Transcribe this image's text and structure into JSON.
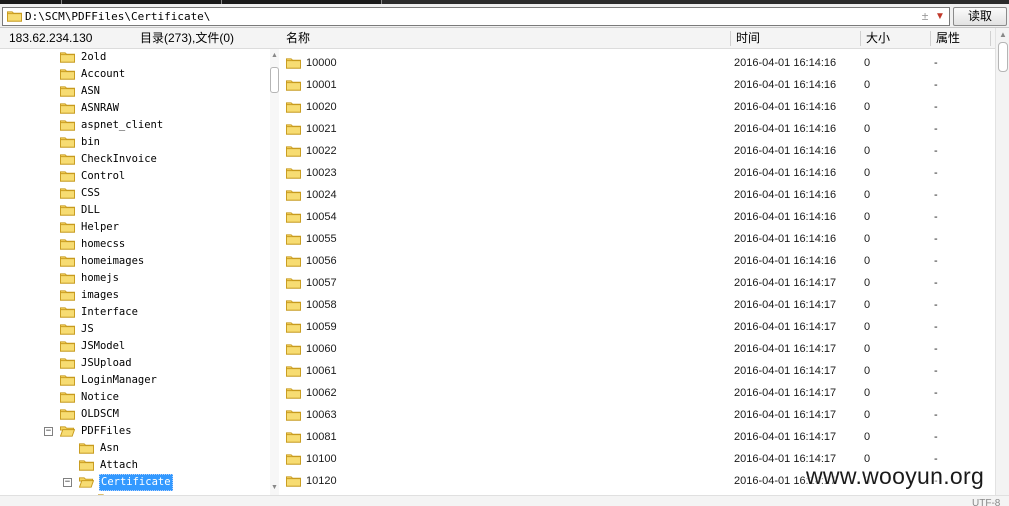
{
  "address_bar": {
    "path": "D:\\SCM\\PDFFiles\\Certificate\\",
    "plus_glyph": "±",
    "dropdown_glyph": "▼",
    "read_label": "读取"
  },
  "header": {
    "ip": "183.62.234.130",
    "count_label": "目录(273),文件(0)",
    "columns": {
      "name": "名称",
      "time": "时间",
      "size": "大小",
      "attr": "属性"
    }
  },
  "tree": {
    "items": [
      {
        "label": "2old"
      },
      {
        "label": "Account"
      },
      {
        "label": "ASN"
      },
      {
        "label": "ASNRAW"
      },
      {
        "label": "aspnet_client"
      },
      {
        "label": "bin"
      },
      {
        "label": "CheckInvoice"
      },
      {
        "label": "Control"
      },
      {
        "label": "CSS"
      },
      {
        "label": "DLL"
      },
      {
        "label": "Helper"
      },
      {
        "label": "homecss"
      },
      {
        "label": "homeimages"
      },
      {
        "label": "homejs"
      },
      {
        "label": "images"
      },
      {
        "label": "Interface"
      },
      {
        "label": "JS"
      },
      {
        "label": "JSModel"
      },
      {
        "label": "JSUpload"
      },
      {
        "label": "LoginManager"
      },
      {
        "label": "Notice"
      },
      {
        "label": "OLDSCM"
      },
      {
        "label": "PDFFiles",
        "expander": "−"
      },
      {
        "label": "Asn"
      },
      {
        "label": "Attach"
      },
      {
        "label": "Certificate",
        "expander": "−"
      }
    ]
  },
  "files": [
    {
      "name": "10000",
      "time": "2016-04-01 16:14:16",
      "size": "0",
      "attr": "-"
    },
    {
      "name": "10001",
      "time": "2016-04-01 16:14:16",
      "size": "0",
      "attr": "-"
    },
    {
      "name": "10020",
      "time": "2016-04-01 16:14:16",
      "size": "0",
      "attr": "-"
    },
    {
      "name": "10021",
      "time": "2016-04-01 16:14:16",
      "size": "0",
      "attr": "-"
    },
    {
      "name": "10022",
      "time": "2016-04-01 16:14:16",
      "size": "0",
      "attr": "-"
    },
    {
      "name": "10023",
      "time": "2016-04-01 16:14:16",
      "size": "0",
      "attr": "-"
    },
    {
      "name": "10024",
      "time": "2016-04-01 16:14:16",
      "size": "0",
      "attr": "-"
    },
    {
      "name": "10054",
      "time": "2016-04-01 16:14:16",
      "size": "0",
      "attr": "-"
    },
    {
      "name": "10055",
      "time": "2016-04-01 16:14:16",
      "size": "0",
      "attr": "-"
    },
    {
      "name": "10056",
      "time": "2016-04-01 16:14:16",
      "size": "0",
      "attr": "-"
    },
    {
      "name": "10057",
      "time": "2016-04-01 16:14:17",
      "size": "0",
      "attr": "-"
    },
    {
      "name": "10058",
      "time": "2016-04-01 16:14:17",
      "size": "0",
      "attr": "-"
    },
    {
      "name": "10059",
      "time": "2016-04-01 16:14:17",
      "size": "0",
      "attr": "-"
    },
    {
      "name": "10060",
      "time": "2016-04-01 16:14:17",
      "size": "0",
      "attr": "-"
    },
    {
      "name": "10061",
      "time": "2016-04-01 16:14:17",
      "size": "0",
      "attr": "-"
    },
    {
      "name": "10062",
      "time": "2016-04-01 16:14:17",
      "size": "0",
      "attr": "-"
    },
    {
      "name": "10063",
      "time": "2016-04-01 16:14:17",
      "size": "0",
      "attr": "-"
    },
    {
      "name": "10081",
      "time": "2016-04-01 16:14:17",
      "size": "0",
      "attr": "-"
    },
    {
      "name": "10100",
      "time": "2016-04-01 16:14:17",
      "size": "0",
      "attr": "-"
    },
    {
      "name": "10120",
      "time": "2016-04-01 16:14:17",
      "size": "0",
      "attr": "-"
    }
  ],
  "status": {
    "encoding": "UTF-8"
  },
  "watermark": "www.wooyun.org",
  "icons": {
    "folder": "folder-icon",
    "folder_open": "folder-open-icon"
  },
  "colors": {
    "selection": "#3399ff",
    "folder_fill": "#f4d35e",
    "folder_stroke": "#c79a1e",
    "dropdown": "#c0392b"
  }
}
